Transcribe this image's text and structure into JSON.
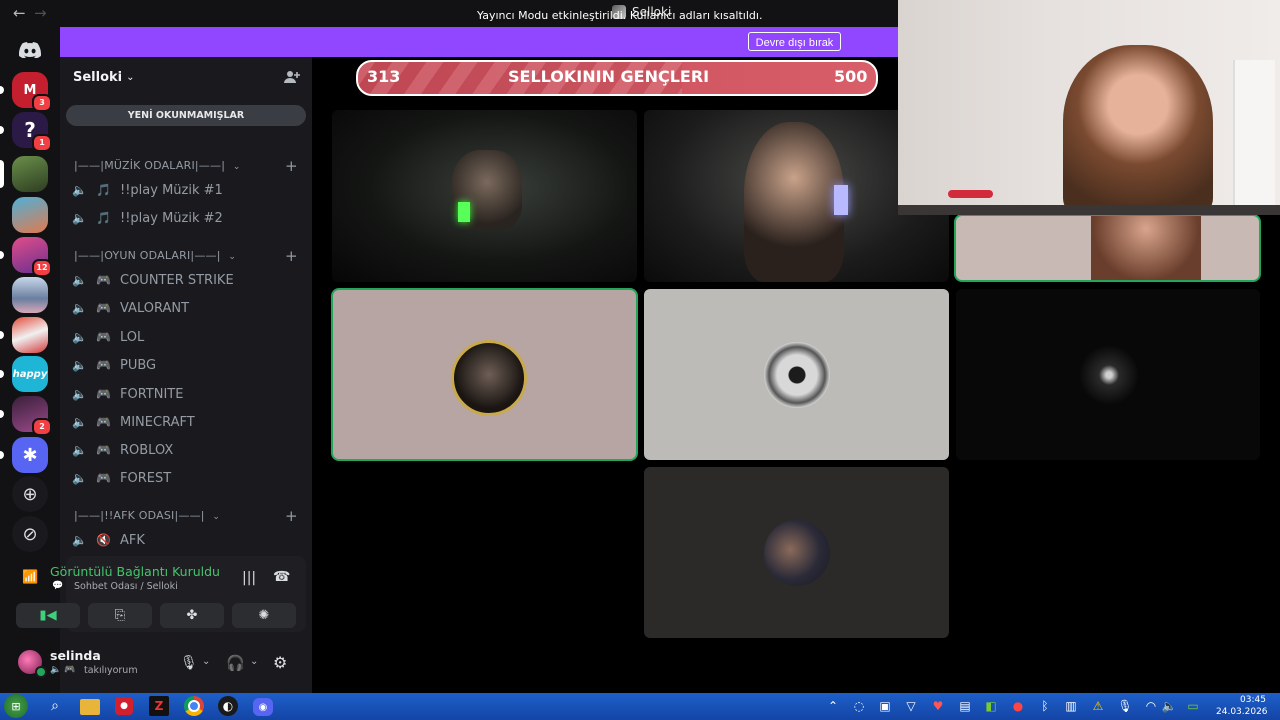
{
  "window": {
    "title": "Selloki"
  },
  "banner": {
    "text": "Yayıncı Modu etkinleştirildi. Kullanıcı adları kısaltıldı.",
    "button": "Devre dışı bırak"
  },
  "rail": {
    "servers": [
      {
        "icon": "discord-logo-icon"
      },
      {
        "label": "M",
        "badge": "3",
        "color": "#c41f2e"
      },
      {
        "label": "?",
        "badge": "1",
        "color": "#2a1a45"
      },
      {
        "label": "",
        "color": "#4d7a3a"
      },
      {
        "label": "",
        "color": "#d86a4a"
      },
      {
        "label": "",
        "badge": "12",
        "color": "#c1447e"
      },
      {
        "label": "",
        "color": "#8fa8c8"
      },
      {
        "label": "",
        "color": "#d23b3b"
      },
      {
        "label": "happy",
        "color": "#1fb5d6"
      },
      {
        "label": "",
        "badge": "2",
        "color": "#5a2a55"
      },
      {
        "label": "",
        "color": "#5865f2"
      }
    ]
  },
  "sidebar": {
    "server_name": "Selloki",
    "unread_pill": "YENİ OKUNMAMIŞLAR",
    "categories": [
      {
        "label": "|——|MÜZİK ODALARI|——|"
      },
      {
        "label": "|——|OYUN ODALARI|——|"
      },
      {
        "label": "|——|!!AFK ODASI|——|"
      }
    ],
    "music_channels": [
      {
        "emoji": "🎵",
        "name": "!!play Müzik #1"
      },
      {
        "emoji": "🎵",
        "name": "!!play Müzik #2"
      }
    ],
    "game_channels": [
      {
        "emoji": "🎮",
        "name": "COUNTER STRIKE"
      },
      {
        "emoji": "🎮",
        "name": "VALORANT"
      },
      {
        "emoji": "🎮",
        "name": "LOL"
      },
      {
        "emoji": "🎮",
        "name": "PUBG"
      },
      {
        "emoji": "🎮",
        "name": "FORTNITE"
      },
      {
        "emoji": "🎮",
        "name": "MINECRAFT"
      },
      {
        "emoji": "🎮",
        "name": "ROBLOX"
      },
      {
        "emoji": "🎮",
        "name": "FOREST"
      }
    ],
    "afk_channels": [
      {
        "emoji": "🔇",
        "name": "AFK"
      }
    ]
  },
  "voice": {
    "status": "Görüntülü Bağlantı Kuruldu",
    "channel": "Sohbet Odası / Selloki"
  },
  "user": {
    "name": "selinda",
    "status": "takılıyorum"
  },
  "goal": {
    "current": "313",
    "title": "SELLOKININ GENÇLERI",
    "max": "500",
    "progress": 0.626
  },
  "taskbar": {
    "time": "03:45",
    "date": "24.03.2026"
  }
}
